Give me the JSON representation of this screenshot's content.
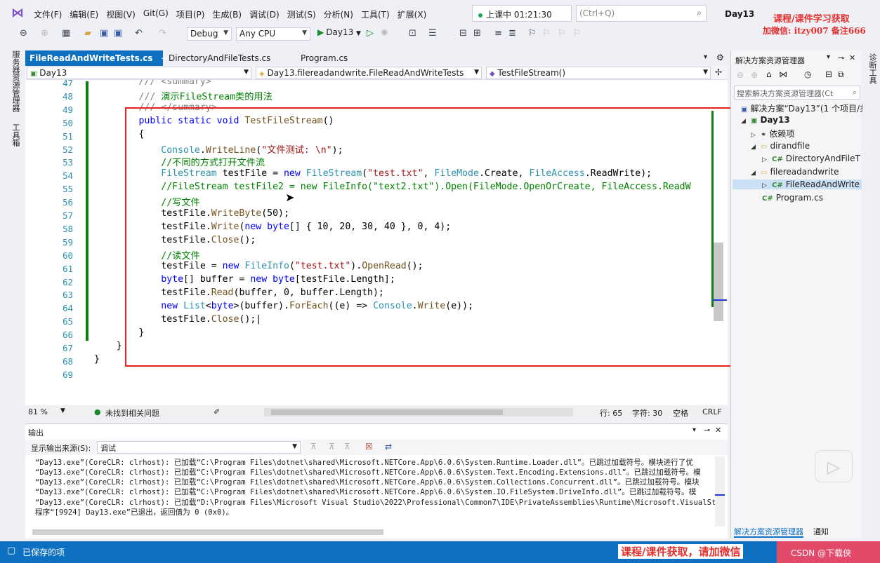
{
  "menu": {
    "items": [
      "文件(F)",
      "编辑(E)",
      "视图(V)",
      "Git(G)",
      "项目(P)",
      "生成(B)",
      "调试(D)",
      "测试(S)",
      "分析(N)",
      "工具(T)",
      "扩展(X)"
    ],
    "live_status": "上课中 01:21:30",
    "search_placeholder": "(Ctrl+Q)",
    "project_name": "Day13",
    "watermark_top1": "课程/课件学习获取",
    "watermark_top2": "加微信: itzy007 备注666"
  },
  "toolbar": {
    "config": "Debug",
    "platform": "Any CPU",
    "run_label": "Day13"
  },
  "left_strip": {
    "server_explorer": "服务器资源管理器",
    "toolbox": "工具箱"
  },
  "tabs": [
    {
      "label": "FileReadAndWriteTests.cs",
      "active": true
    },
    {
      "label": "DirectoryAndFileTests.cs",
      "active": false
    },
    {
      "label": "Program.cs",
      "active": false
    }
  ],
  "navbar": {
    "project": "Day13",
    "class": "Day13.filereadandwrite.FileReadAndWriteTests",
    "member": "TestFileStream()"
  },
  "editor": {
    "line_numbers": [
      "47",
      "48",
      "49",
      "50",
      "51",
      "52",
      "53",
      "54",
      "55",
      "56",
      "57",
      "58",
      "59",
      "60",
      "61",
      "62",
      "63",
      "64",
      "65",
      "66",
      "67",
      "68",
      "69"
    ]
  },
  "editor_status": {
    "zoom": "81 %",
    "issues": "未找到相关问题",
    "line": "行: 65",
    "char": "字符: 30",
    "whitespace": "空格",
    "eol": "CRLF"
  },
  "output": {
    "title": "输出",
    "source_label": "显示输出来源(S):",
    "source_value": "调试",
    "lines": [
      "“Day13.exe”(CoreCLR: clrhost): 已加载“C:\\Program Files\\dotnet\\shared\\Microsoft.NETCore.App\\6.0.6\\System.Runtime.Loader.dll”。已跳过加载符号。模块进行了优",
      "“Day13.exe”(CoreCLR: clrhost): 已加载“C:\\Program Files\\dotnet\\shared\\Microsoft.NETCore.App\\6.0.6\\System.Text.Encoding.Extensions.dll”。已跳过加载符号。模",
      "“Day13.exe”(CoreCLR: clrhost): 已加载“C:\\Program Files\\dotnet\\shared\\Microsoft.NETCore.App\\6.0.6\\System.Collections.Concurrent.dll”。已跳过加载符号。模块",
      "“Day13.exe”(CoreCLR: clrhost): 已加载“C:\\Program Files\\dotnet\\shared\\Microsoft.NETCore.App\\6.0.6\\System.IO.FileSystem.DriveInfo.dll”。已跳过加载符号。模",
      "“Day13.exe”(CoreCLR: clrhost): 已加载“D:\\Program Files\\Microsoft Visual Studio\\2022\\Professional\\Common7\\IDE\\PrivateAssemblies\\Runtime\\Microsoft.VisualSt",
      "程序“[9924] Day13.exe”已退出，返回值为 0 (0x0)。"
    ]
  },
  "solution": {
    "title": "解决方案资源管理器",
    "search_placeholder": "搜索解决方案资源管理器(Ct",
    "solution_label": "解决方案“Day13”(1 个项目/共",
    "project": "Day13",
    "deps": "依赖项",
    "folder1": "dirandfile",
    "file1": "DirectoryAndFileT",
    "folder2": "filereadandwrite",
    "file2": "FileReadAndWrite",
    "file3": "Program.cs",
    "tab1": "解决方案资源管理器",
    "tab2": "通知",
    "right_strip": "诊断工具"
  },
  "statusbar": {
    "text": "已保存的项",
    "watermark_bottom": "课程/课件获取，请加微信",
    "csdn": "CSDN @下载侠"
  },
  "colors": {
    "accent": "#0e70c0",
    "change_bar": "#107c10",
    "highlight_box": "#e81f1f"
  }
}
